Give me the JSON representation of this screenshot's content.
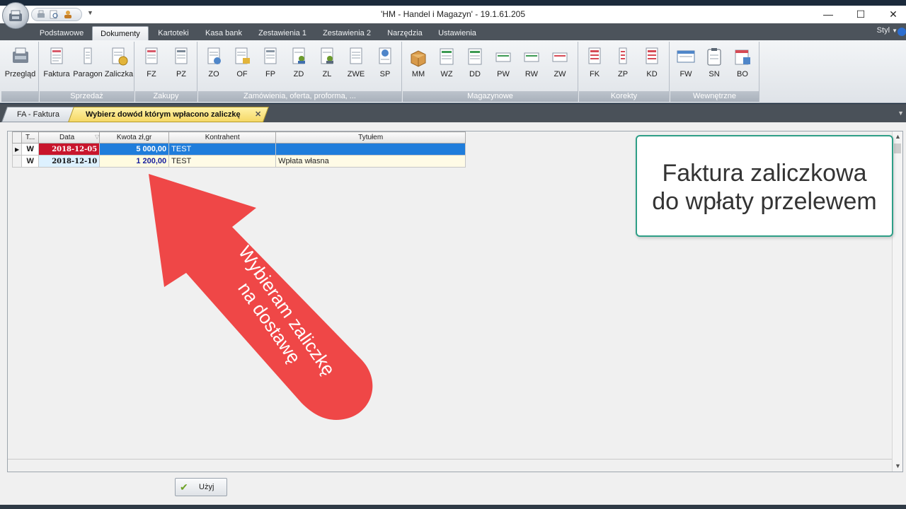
{
  "window": {
    "title": "'HM - Handel i Magazyn'  -  19.1.61.205",
    "minimize": "—",
    "maximize": "☐",
    "close": "✕"
  },
  "ribbon_tabs": [
    "Podstawowe",
    "Dokumenty",
    "Kartoteki",
    "Kasa bank",
    "Zestawienia 1",
    "Zestawienia 2",
    "Narzędzia",
    "Ustawienia"
  ],
  "active_tab": "Dokumenty",
  "style_label": "Styl",
  "groups": [
    {
      "caption": "",
      "buttons": [
        "Przegląd"
      ]
    },
    {
      "caption": "Sprzedaż",
      "buttons": [
        "Faktura",
        "Paragon",
        "Zaliczka"
      ]
    },
    {
      "caption": "Zakupy",
      "buttons": [
        "FZ",
        "PZ"
      ]
    },
    {
      "caption": "Zamówienia, oferta, proforma, ...",
      "buttons": [
        "ZO",
        "OF",
        "FP",
        "ZD",
        "ZL",
        "ZWE",
        "SP"
      ]
    },
    {
      "caption": "Magazynowe",
      "buttons": [
        "MM",
        "WZ",
        "DD",
        "PW",
        "RW",
        "ZW"
      ]
    },
    {
      "caption": "Korekty",
      "buttons": [
        "FK",
        "ZP",
        "KD"
      ]
    },
    {
      "caption": "Wewnętrzne",
      "buttons": [
        "FW",
        "SN",
        "BO"
      ]
    }
  ],
  "doc_tabs": {
    "tab1": "FA - Faktura",
    "tab2": "Wybierz dowód którym wpłacono zaliczkę",
    "close": "✕"
  },
  "grid": {
    "columns": [
      "T...",
      "Data",
      "Kwota   zł,gr",
      "Kontrahent",
      "Tytułem"
    ],
    "rows": [
      {
        "type": "W",
        "date": "2018-12-05",
        "amount": "5 000,00",
        "contractor": "TEST",
        "title": ""
      },
      {
        "type": "W",
        "date": "2018-12-10",
        "amount": "1 200,00",
        "contractor": "TEST",
        "title": "Wpłata własna"
      }
    ]
  },
  "callout": {
    "line1": "Faktura zaliczkowa",
    "line2": "do wpłaty przelewem"
  },
  "arrow_text": {
    "line1": "Wybieram zaliczkę",
    "line2": "na dostawę"
  },
  "use_button": "Użyj",
  "colors": {
    "selected_row": "#1f7ddb",
    "date_highlight": "#c8152c",
    "arrow": "#ef4747",
    "callout_border": "#2e9f87"
  }
}
